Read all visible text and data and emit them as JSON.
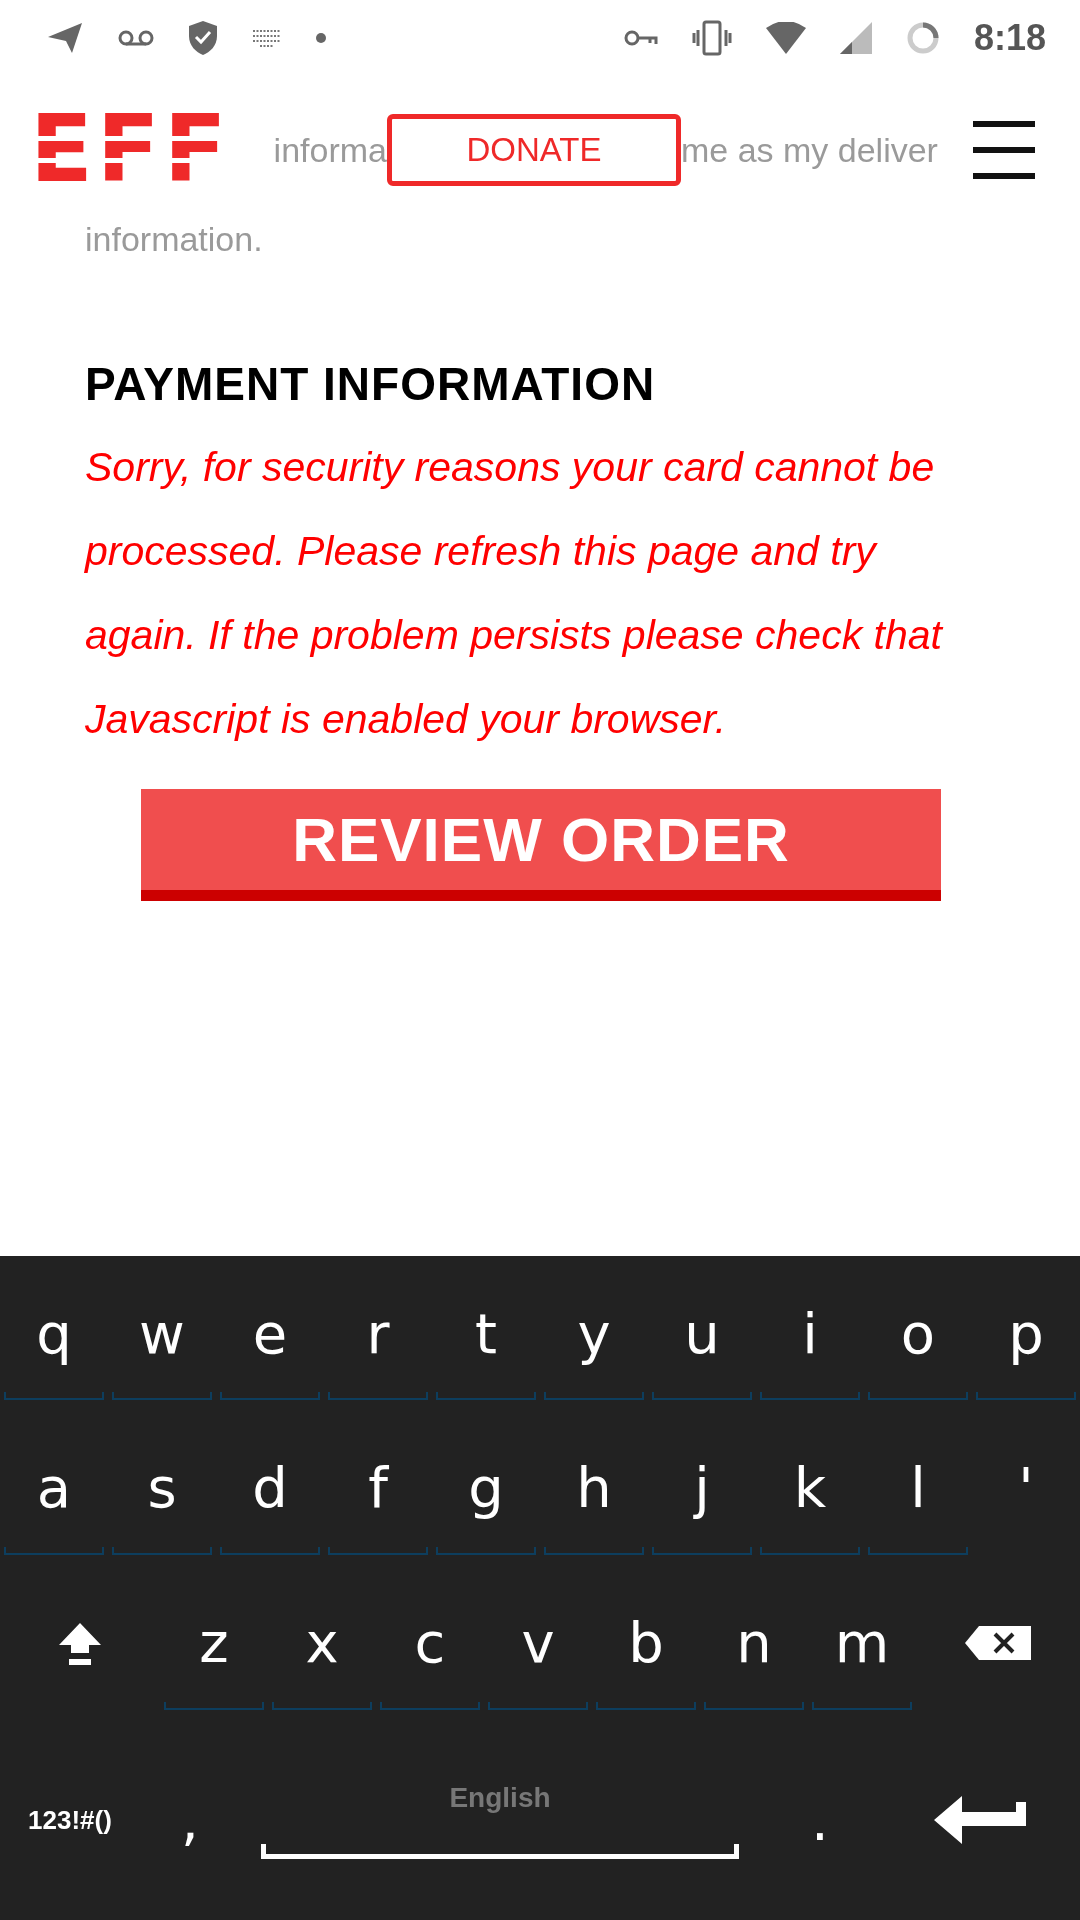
{
  "status_bar": {
    "time": "8:18"
  },
  "header": {
    "logo": "EFF",
    "donate": "DONATE"
  },
  "billing_option": {
    "fragments": [
      "informa",
      "me as my deliver",
      "information."
    ]
  },
  "payment": {
    "heading": "PAYMENT INFORMATION",
    "error": "Sorry, for security reasons your card cannot be processed. Please refresh this page and try again. If the problem persists please check that Javascript is enabled your browser."
  },
  "review_button": "REVIEW ORDER",
  "keyboard": {
    "rows": [
      [
        {
          "kind": "letter",
          "label": "q"
        },
        {
          "kind": "letter",
          "label": "w"
        },
        {
          "kind": "letter",
          "label": "e"
        },
        {
          "kind": "letter",
          "label": "r"
        },
        {
          "kind": "letter",
          "label": "t"
        },
        {
          "kind": "letter",
          "label": "y"
        },
        {
          "kind": "letter",
          "label": "u"
        },
        {
          "kind": "letter",
          "label": "i"
        },
        {
          "kind": "letter",
          "label": "o"
        },
        {
          "kind": "letter",
          "label": "p"
        }
      ],
      [
        {
          "kind": "letter",
          "label": "a"
        },
        {
          "kind": "letter",
          "label": "s"
        },
        {
          "kind": "letter",
          "label": "d"
        },
        {
          "kind": "letter",
          "label": "f"
        },
        {
          "kind": "letter",
          "label": "g"
        },
        {
          "kind": "letter",
          "label": "h"
        },
        {
          "kind": "letter",
          "label": "j"
        },
        {
          "kind": "letter",
          "label": "k"
        },
        {
          "kind": "letter",
          "label": "l"
        },
        {
          "kind": "punct",
          "label": "'"
        }
      ],
      [
        {
          "kind": "shift"
        },
        {
          "kind": "letter",
          "label": "z"
        },
        {
          "kind": "letter",
          "label": "x"
        },
        {
          "kind": "letter",
          "label": "c"
        },
        {
          "kind": "letter",
          "label": "v"
        },
        {
          "kind": "letter",
          "label": "b"
        },
        {
          "kind": "letter",
          "label": "n"
        },
        {
          "kind": "letter",
          "label": "m"
        },
        {
          "kind": "backspace"
        }
      ]
    ],
    "bottom_row": {
      "symbols": "123!#()",
      "comma": ",",
      "space_language": "English",
      "period": "."
    }
  }
}
